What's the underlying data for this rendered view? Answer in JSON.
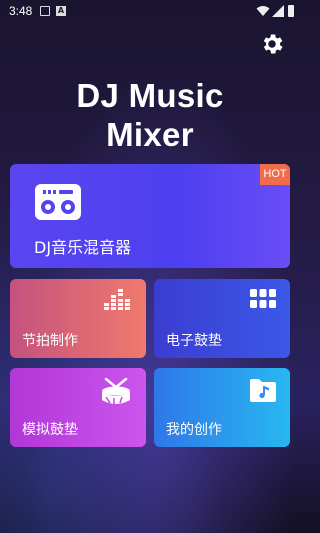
{
  "status_bar": {
    "time": "3:48",
    "notification_letter": "A"
  },
  "title_line1": "DJ Music",
  "title_line2": "Mixer",
  "main_card": {
    "label": "DJ音乐混音器",
    "badge": "HOT"
  },
  "cards": [
    {
      "label": "节拍制作"
    },
    {
      "label": "电子鼓垫"
    },
    {
      "label": "模拟鼓垫"
    },
    {
      "label": "我的创作"
    }
  ]
}
